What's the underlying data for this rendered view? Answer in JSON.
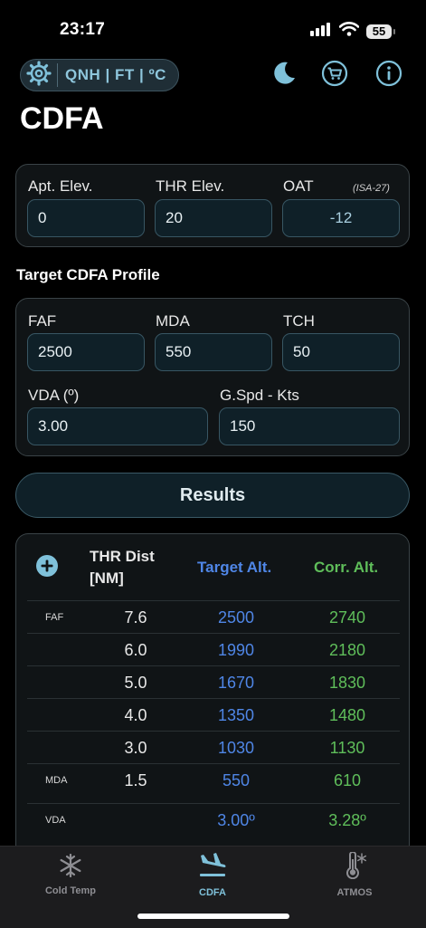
{
  "status": {
    "time": "23:17",
    "battery": "55"
  },
  "header": {
    "units": "QNH | FT | ºC",
    "title": "CDFA"
  },
  "airport": {
    "apt_elev_label": "Apt. Elev.",
    "apt_elev_value": "0",
    "thr_elev_label": "THR Elev.",
    "thr_elev_value": "20",
    "oat_label": "OAT",
    "isa_note": "(ISA-27)",
    "oat_value": "-12"
  },
  "profile": {
    "section_title": "Target CDFA Profile",
    "faf_label": "FAF",
    "faf_value": "2500",
    "mda_label": "MDA",
    "mda_value": "550",
    "tch_label": "TCH",
    "tch_value": "50",
    "vda_label": "VDA (º)",
    "vda_value": "3.00",
    "gspd_label": "G.Spd - Kts",
    "gspd_value": "150"
  },
  "results_button": "Results",
  "table": {
    "col_dist_line1": "THR Dist",
    "col_dist_line2": "[NM]",
    "col_target": "Target Alt.",
    "col_corr": "Corr. Alt.",
    "rows": [
      {
        "tag": "FAF",
        "dist": "7.6",
        "target": "2500",
        "corr": "2740"
      },
      {
        "tag": "",
        "dist": "6.0",
        "target": "1990",
        "corr": "2180"
      },
      {
        "tag": "",
        "dist": "5.0",
        "target": "1670",
        "corr": "1830"
      },
      {
        "tag": "",
        "dist": "4.0",
        "target": "1350",
        "corr": "1480"
      },
      {
        "tag": "",
        "dist": "3.0",
        "target": "1030",
        "corr": "1130"
      },
      {
        "tag": "MDA",
        "dist": "1.5",
        "target": "550",
        "corr": "610"
      },
      {
        "tag": "VDA",
        "dist": "",
        "target": "3.00º",
        "corr": "3.28º"
      }
    ]
  },
  "tabs": [
    {
      "label": "Cold Temp",
      "icon": "snowflake-icon",
      "active": false
    },
    {
      "label": "CDFA",
      "icon": "airplane-landing-icon",
      "active": true
    },
    {
      "label": "ATMOS",
      "icon": "thermometer-icon",
      "active": false
    }
  ],
  "colors": {
    "accent": "#7fc1da",
    "target": "#4f86e6",
    "corr": "#5fbe5a",
    "inactive_tab": "#8e8e93"
  }
}
